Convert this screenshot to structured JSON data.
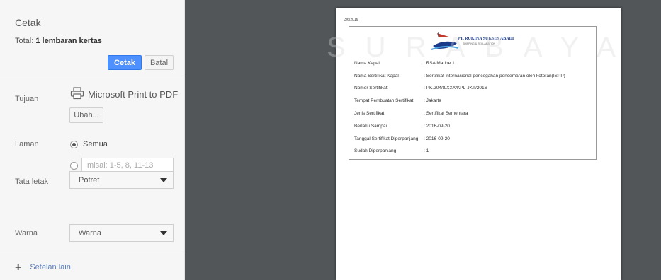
{
  "sidebar": {
    "title": "Cetak",
    "total_prefix": "Total:",
    "total_value": "1 lembaran kertas",
    "print_button": "Cetak",
    "cancel_button": "Batal",
    "destination_label": "Tujuan",
    "destination_name": "Microsoft Print to PDF",
    "change_button": "Ubah...",
    "pages_label": "Laman",
    "pages_all": "Semua",
    "pages_placeholder": "misal: 1-5, 8, 11-13",
    "layout_label": "Tata letak",
    "layout_value": "Potret",
    "color_label": "Warna",
    "color_value": "Warna",
    "more_settings": "Setelan lain"
  },
  "preview": {
    "watermark": "SURABAYA",
    "date": "3/6/2016",
    "company": "PT. RUKINA SUKSES ABADI",
    "tagline": "SHIPPING & RECLAMATION",
    "rows": [
      {
        "k": "Nama Kapal",
        "v": ": RSA Marine 1"
      },
      {
        "k": "Nama Sertifikat Kapal",
        "v": ": Sertifikat internasional pencegahan pencemaran oleh kotoran(ISPP)"
      },
      {
        "k": "Nomor Sertifikat",
        "v": ": PK.204/8/XXX/KPL-JKT/2016"
      },
      {
        "k": "Tempat Pembuatan Sertifikat",
        "v": ": Jakarta"
      },
      {
        "k": "Jenis Sertifikat",
        "v": ": Sertifikat Sementara"
      },
      {
        "k": "Berlaku Sampai",
        "v": ": 2016-09-20"
      },
      {
        "k": "Tanggal Sertifikat Diperpanjang",
        "v": ": 2016-09-20"
      },
      {
        "k": "Sudah Diperpanjang",
        "v": ": 1"
      }
    ]
  },
  "colors": {
    "accent": "#4d90fe",
    "preview_bg": "#525659",
    "sidebar_bg": "#f6f6f6"
  },
  "icons": {
    "destination": "printer-icon",
    "more": "plus-icon",
    "layout_caret": "chevron-down-icon"
  }
}
